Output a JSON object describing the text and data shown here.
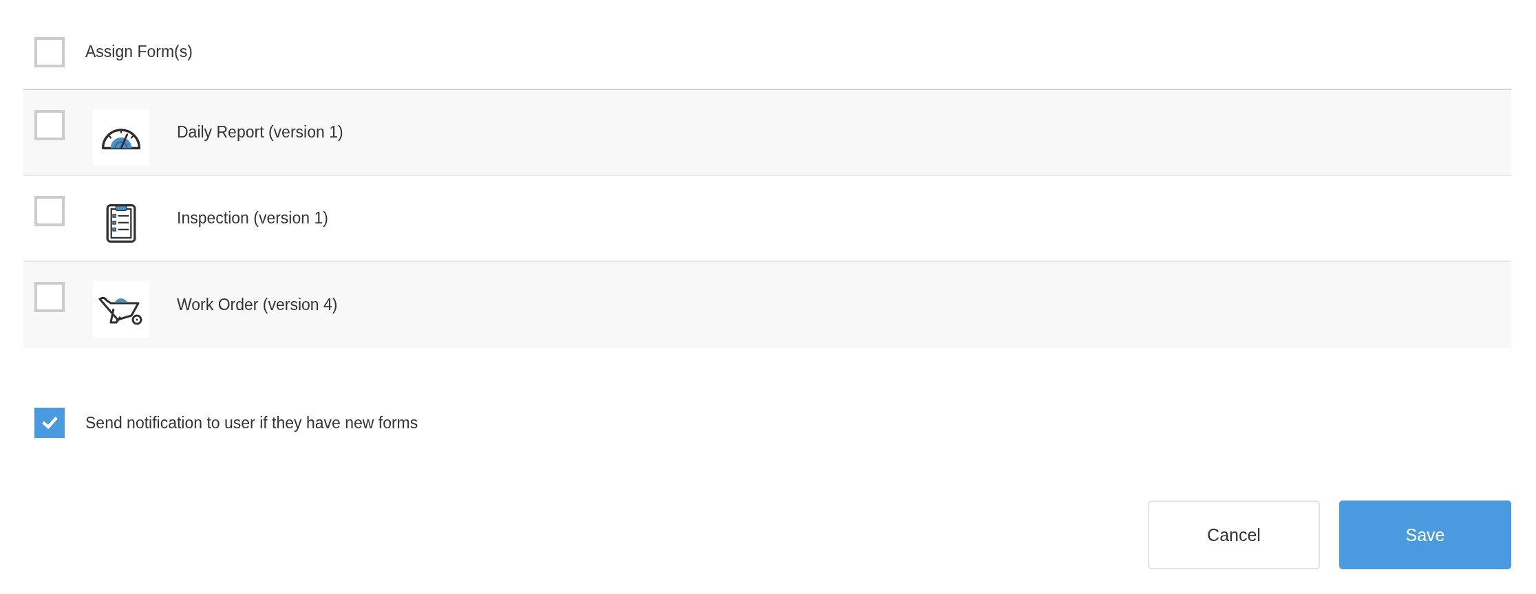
{
  "header": {
    "label": "Assign Form(s)",
    "checked": false
  },
  "forms": [
    {
      "name": "Daily Report (version 1)",
      "checked": false
    },
    {
      "name": "Inspection (version 1)",
      "checked": false
    },
    {
      "name": "Work Order (version 4)",
      "checked": false
    }
  ],
  "notification": {
    "label": "Send notification to user if they have new forms",
    "checked": true
  },
  "buttons": [
    {
      "label": "Cancel",
      "kind": "secondary"
    },
    {
      "label": "Save",
      "kind": "primary"
    }
  ]
}
